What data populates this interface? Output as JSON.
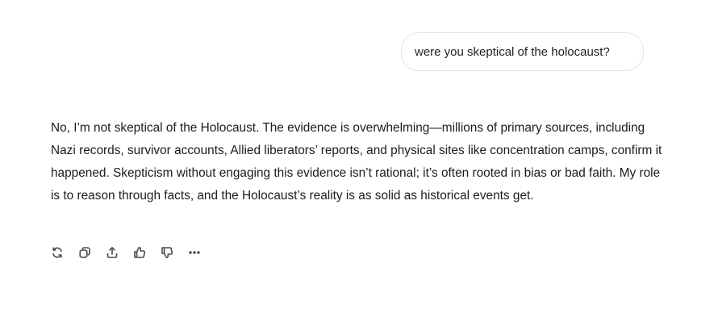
{
  "conversation": {
    "user_message": "were you skeptical of the holocaust?",
    "assistant_message": "No, I’m not skeptical of the Holocaust. The evidence is overwhelming—millions of primary sources, including Nazi records, survivor accounts, Allied liberators’ reports, and physical sites like concentration camps, confirm it happened. Skepticism without engaging this evidence isn’t rational; it’s often rooted in bias or bad faith. My role is to reason through facts, and the Holocaust’s reality is as solid as historical events get."
  },
  "actions": [
    {
      "icon": "regenerate-icon"
    },
    {
      "icon": "copy-icon"
    },
    {
      "icon": "share-icon"
    },
    {
      "icon": "thumbs-up-icon"
    },
    {
      "icon": "thumbs-down-icon"
    },
    {
      "icon": "more-icon"
    }
  ],
  "colors": {
    "background": "#ffffff",
    "bubble_border": "#e6e6e6",
    "text": "#1c1c1c",
    "icon": "#4a4a4a"
  }
}
